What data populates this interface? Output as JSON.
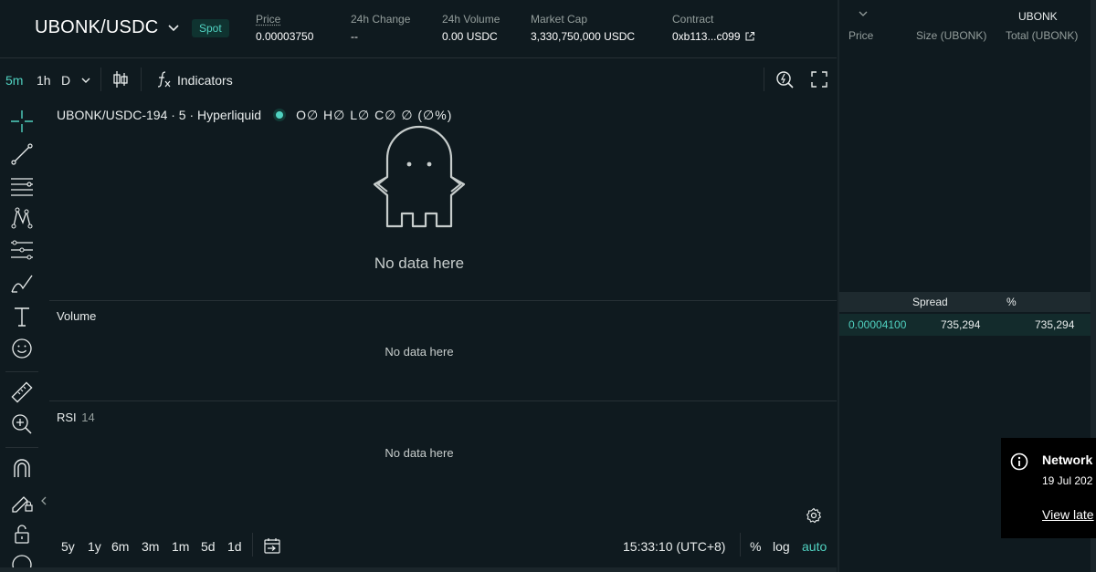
{
  "header": {
    "pair": "UBONK/USDC",
    "market_type": "Spot",
    "stats": [
      {
        "label": "Price",
        "value": "0.00003750"
      },
      {
        "label": "24h Change",
        "value": "--"
      },
      {
        "label": "24h Volume",
        "value": "0.00 USDC"
      },
      {
        "label": "Market Cap",
        "value": "3,330,750,000 USDC"
      },
      {
        "label": "Contract",
        "value": "0xb113...c099"
      }
    ]
  },
  "toolbar": {
    "intervals": [
      "5m",
      "1h",
      "D"
    ],
    "active_interval": "5m",
    "indicators_label": "Indicators"
  },
  "chart": {
    "legend": {
      "symbol": "UBONK/USDC-194 · 5 · Hyperliquid",
      "ohlc": "O∅ H∅ L∅ C∅ ∅ (∅%)"
    },
    "empty_main": "No data here",
    "volume_label": "Volume",
    "volume_empty": "No data here",
    "rsi_label": "RSI",
    "rsi_period": "14",
    "rsi_empty": "No data here",
    "ranges": [
      "5y",
      "1y",
      "6m",
      "3m",
      "1m",
      "5d",
      "1d"
    ],
    "time": "15:33:10 (UTC+8)",
    "scales": {
      "percent": "%",
      "log": "log",
      "auto": "auto"
    }
  },
  "orderbook": {
    "asset_select": "UBONK",
    "columns": {
      "price": "Price",
      "size": "Size (UBONK)",
      "total": "Total (UBONK)"
    },
    "spread_label": "Spread",
    "spread_percent": "%",
    "row": {
      "price": "0.00004100",
      "size": "735,294",
      "total": "735,294"
    }
  },
  "toast": {
    "title": "Network",
    "date": "19 Jul 202",
    "link": "View late"
  },
  "colors": {
    "background": "#0f1a1f",
    "accent": "#50d2c1",
    "muted": "#949e9c",
    "border": "#273035"
  }
}
